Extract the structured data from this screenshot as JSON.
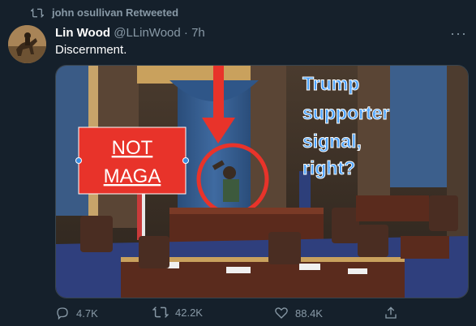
{
  "retweet": {
    "label": "john osullivan Retweeted"
  },
  "tweet": {
    "author_name": "Lin Wood",
    "handle": "@LLinWood",
    "separator": "·",
    "time": "7h",
    "text": "Discernment.",
    "more_label": "···"
  },
  "media": {
    "sign_line1": "NOT",
    "sign_line2": "MAGA",
    "caption_lines": [
      "Trump",
      "supporter",
      "signal,",
      "right?"
    ]
  },
  "actions": {
    "replies": "4.7K",
    "retweets": "42.2K",
    "likes": "88.4K"
  },
  "colors": {
    "background": "#15202b",
    "muted": "#8899a6",
    "sign_red": "#e8332a",
    "caption_blue": "#4da3ff"
  },
  "icons": [
    "retweet-icon",
    "reply-icon",
    "like-icon",
    "share-icon",
    "more-icon"
  ]
}
